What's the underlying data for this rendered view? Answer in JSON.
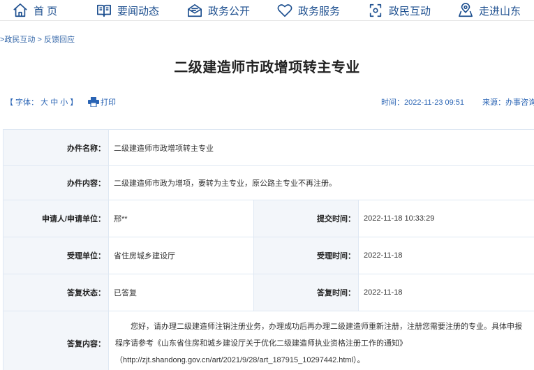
{
  "nav": [
    {
      "label": "首 页",
      "icon": "home-icon"
    },
    {
      "label": "要闻动态",
      "icon": "news-book-icon"
    },
    {
      "label": "政务公开",
      "icon": "mailbox-icon"
    },
    {
      "label": "政务服务",
      "icon": "heart-icon"
    },
    {
      "label": "政民互动",
      "icon": "interaction-icon"
    },
    {
      "label": "走进山东",
      "icon": "location-map-icon"
    }
  ],
  "breadcrumb": ">政民互动 > 反馈回应",
  "page_title": "二级建造师市政增项转主专业",
  "meta": {
    "font_label": "【 字体：",
    "font_large": "大",
    "font_medium": "中",
    "font_small": "小",
    "font_end": "】",
    "print_label": "打印",
    "time_label": "时间：",
    "time_value": "2022-11-23 09:51",
    "source_label": "来源：",
    "source_value": "办事咨询"
  },
  "record": {
    "item_name_label": "办件名称：",
    "item_name": "二级建造师市政增项转主专业",
    "content_label": "办件内容：",
    "content": "二级建造师市政为增项，要转为主专业，原公路主专业不再注册。",
    "applicant_label": "申请人/申请单位：",
    "applicant": "邢**",
    "submit_time_label": "提交时间：",
    "submit_time": "2022-11-18 10:33:29",
    "handling_unit_label": "受理单位：",
    "handling_unit": "省住房城乡建设厅",
    "accept_time_label": "受理时间：",
    "accept_time": "2022-11-18",
    "reply_status_label": "答复状态：",
    "reply_status": "已答复",
    "reply_time_label": "答复时间：",
    "reply_time": "2022-11-18",
    "reply_content_label": "答复内容：",
    "reply_content": "您好，请办理二级建造师注销注册业务，办理成功后再办理二级建造师重新注册，注册您需要注册的专业。具体申报程序请参考《山东省住房和城乡建设厅关于优化二级建造师执业资格注册工作的通知》（http://zjt.shandong.gov.cn/art/2021/9/28/art_187915_10297442.html）。"
  },
  "colors": {
    "nav_text": "#1d4f8f",
    "link": "#2a64b4",
    "label_bg": "#f3f6fa",
    "border": "#dfe8f3"
  }
}
